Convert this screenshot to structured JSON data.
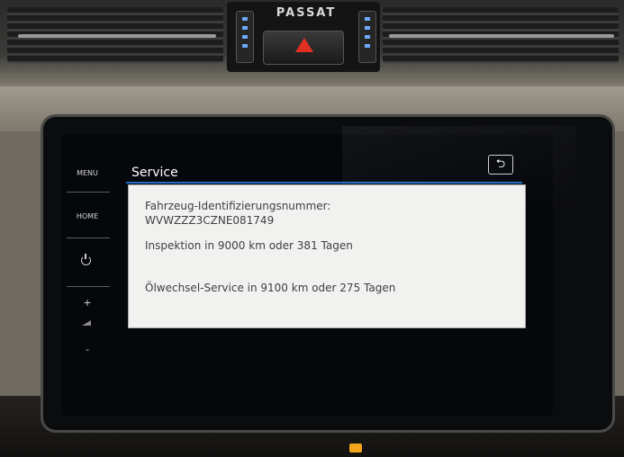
{
  "car": {
    "brand_label": "PASSAT"
  },
  "sidebar": {
    "menu_label": "MENU",
    "home_label": "HOME",
    "power_icon": "power-icon",
    "volume_up_label": "+",
    "volume_down_label": "-"
  },
  "header": {
    "title": "Service",
    "back_icon": "back-arrow-icon",
    "back_glyph": "⮌"
  },
  "service": {
    "vin_label": "Fahrzeug-Identifizierungsnummer:",
    "vin_value": "WVWZZZ3CZNE081749",
    "inspection_text": "Inspektion in 9000 km oder 381 Tagen",
    "oil_change_text": "Ölwechsel-Service in 9100 km oder 275 Tagen"
  },
  "colors": {
    "accent_line": "#1d6ec8",
    "panel_bg": "#f1f2f0",
    "hazard": "#e03024"
  }
}
